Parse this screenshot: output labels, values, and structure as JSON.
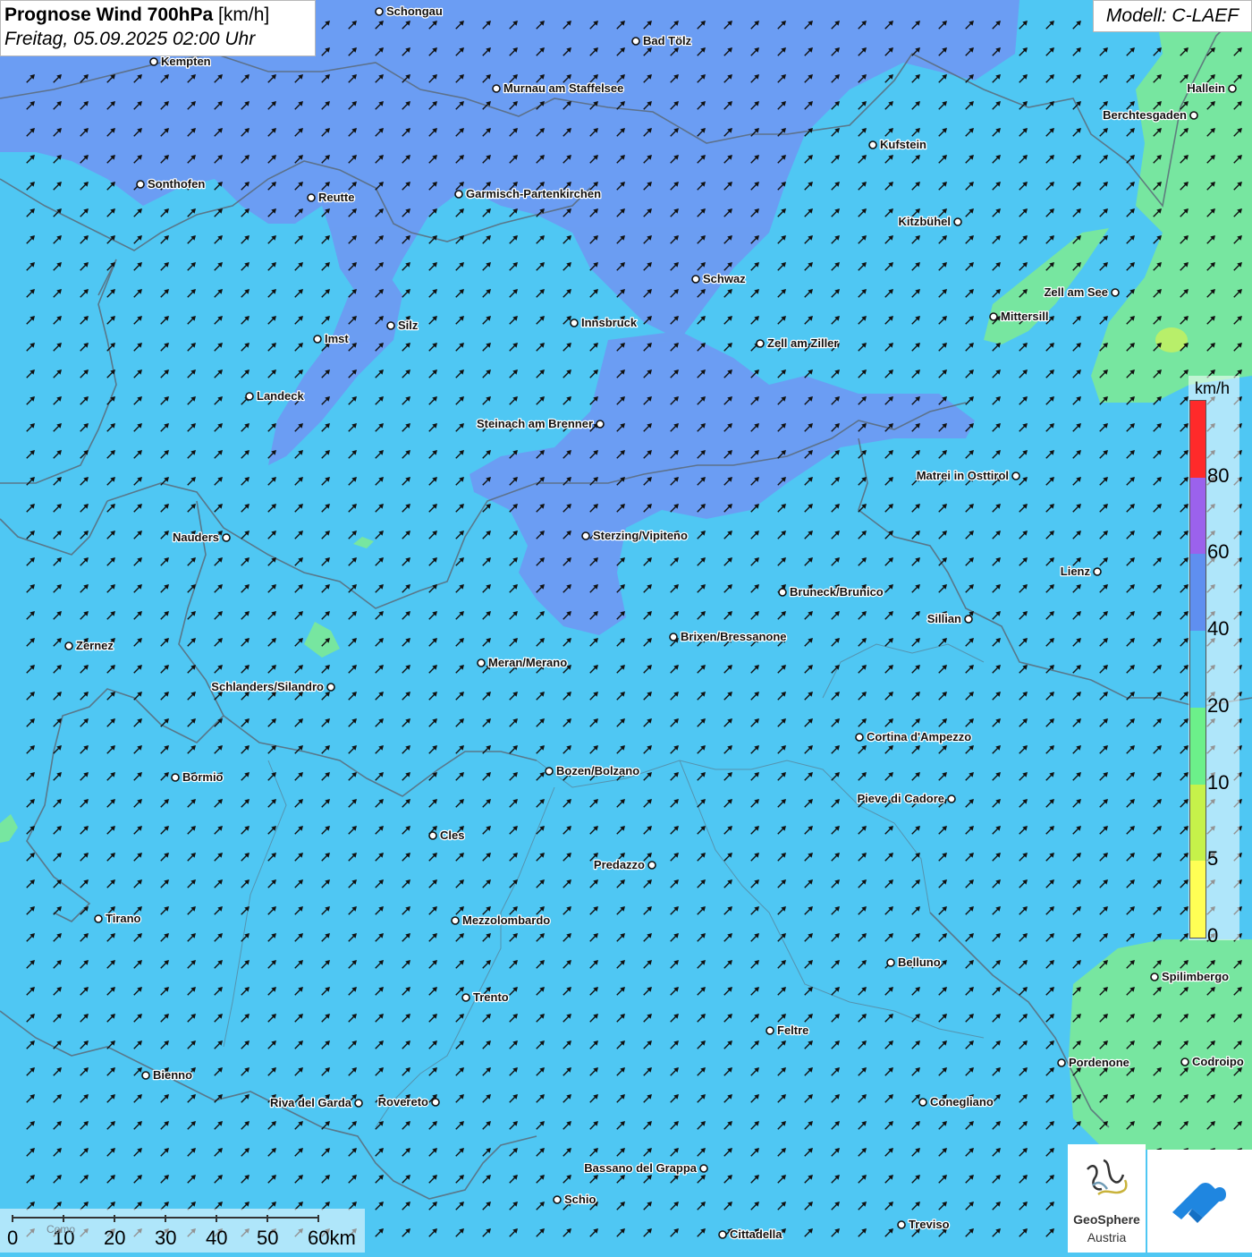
{
  "header": {
    "title_bold": "Prognose Wind 700hPa",
    "title_unit": " [km/h]",
    "datetime": "Freitag, 05.09.2025 02:00 Uhr",
    "model": "Modell: C-LAEF"
  },
  "legend": {
    "unit": "km/h",
    "ticks": [
      "80",
      "60",
      "40",
      "20",
      "10",
      "5",
      "0"
    ],
    "colors": [
      "#ff2a2a",
      "#9b62ec",
      "#5f8ff0",
      "#4dc6f2",
      "#6cf08a",
      "#c6f24a",
      "#ffff55"
    ]
  },
  "scale_bar": {
    "labels": [
      "0",
      "10",
      "20",
      "30",
      "40",
      "50",
      "60km"
    ],
    "faint_label": "Como"
  },
  "wind": {
    "direction": "north-east",
    "dominant_color": "#4fc7f3",
    "strong_color": "#6d9bf2",
    "weak_color": "#77e6a0"
  },
  "cities": [
    {
      "name": "Schongau"
    },
    {
      "name": "Bad Tölz"
    },
    {
      "name": "Kempten"
    },
    {
      "name": "Murnau am Staffelsee"
    },
    {
      "name": "Hallein"
    },
    {
      "name": "Berchtesgaden"
    },
    {
      "name": "Kufstein"
    },
    {
      "name": "Sonthofen"
    },
    {
      "name": "Reutte"
    },
    {
      "name": "Garmisch-Partenkirchen"
    },
    {
      "name": "Kitzbühel"
    },
    {
      "name": "Schwaz"
    },
    {
      "name": "Zell am See"
    },
    {
      "name": "Mittersill"
    },
    {
      "name": "Imst"
    },
    {
      "name": "Silz"
    },
    {
      "name": "Innsbruck"
    },
    {
      "name": "Zell am Ziller"
    },
    {
      "name": "Landeck"
    },
    {
      "name": "Steinach am Brenner"
    },
    {
      "name": "Matrei in Osttirol"
    },
    {
      "name": "Nauders"
    },
    {
      "name": "Sterzing/Vipiteno"
    },
    {
      "name": "Lienz"
    },
    {
      "name": "Bruneck/Brunico"
    },
    {
      "name": "Sillian"
    },
    {
      "name": "Zernez"
    },
    {
      "name": "Brixen/Bressanone"
    },
    {
      "name": "Schlanders/Silandro"
    },
    {
      "name": "Meran/Merano"
    },
    {
      "name": "Cortina d'Ampezzo"
    },
    {
      "name": "Bormio"
    },
    {
      "name": "Bozen/Bolzano"
    },
    {
      "name": "Pieve di Cadore"
    },
    {
      "name": "Cles"
    },
    {
      "name": "Predazzo"
    },
    {
      "name": "Tirano"
    },
    {
      "name": "Mezzolombardo"
    },
    {
      "name": "Belluno"
    },
    {
      "name": "Spilimbergo"
    },
    {
      "name": "Trento"
    },
    {
      "name": "Feltre"
    },
    {
      "name": "Pordenone"
    },
    {
      "name": "Codroipo"
    },
    {
      "name": "Bienno"
    },
    {
      "name": "Riva del Garda"
    },
    {
      "name": "Rovereto"
    },
    {
      "name": "Conegliano"
    },
    {
      "name": "Bassano del Grappa"
    },
    {
      "name": "Schio"
    },
    {
      "name": "Treviso"
    },
    {
      "name": "Cittadella"
    }
  ],
  "logos": {
    "geosphere_name": "GeoSphere",
    "geosphere_sub": "Austria"
  }
}
